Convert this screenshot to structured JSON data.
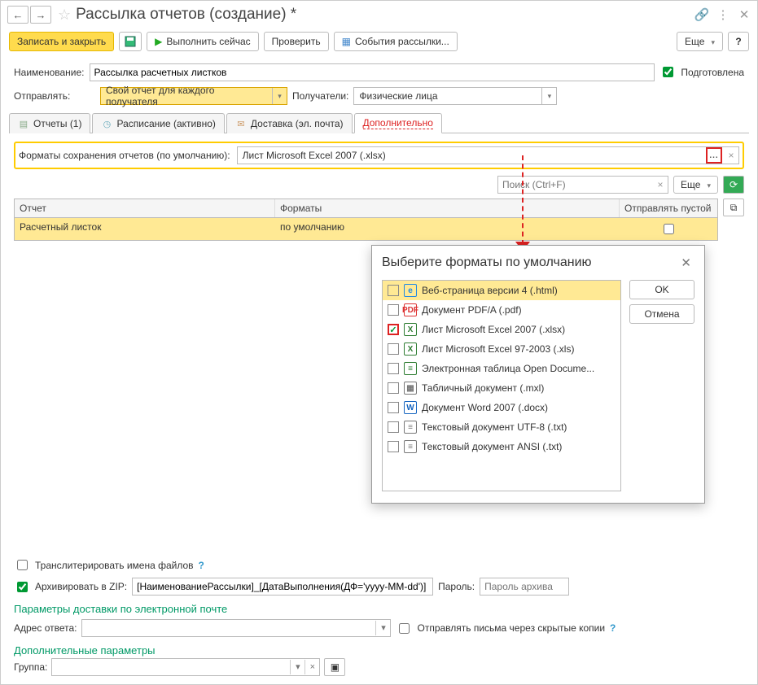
{
  "title": "Рассылка отчетов (создание) *",
  "toolbar": {
    "write_close": "Записать и закрыть",
    "execute_now": "Выполнить сейчас",
    "check": "Проверить",
    "events": "События рассылки...",
    "more": "Еще",
    "help": "?"
  },
  "form": {
    "name_label": "Наименование:",
    "name_value": "Рассылка расчетных листков",
    "prepared_label": "Подготовлена",
    "send_label": "Отправлять:",
    "send_value": "Свой отчет для каждого получателя",
    "recipients_label": "Получатели:",
    "recipients_value": "Физические лица"
  },
  "tabs": {
    "reports": "Отчеты (1)",
    "schedule": "Расписание (активно)",
    "delivery": "Доставка (эл. почта)",
    "additional": "Дополнительно"
  },
  "additional": {
    "formats_label": "Форматы сохранения отчетов (по умолчанию):",
    "formats_value": "Лист Microsoft Excel 2007 (.xlsx)",
    "search_placeholder": "Поиск (Ctrl+F)",
    "more": "Еще",
    "columns": {
      "report": "Отчет",
      "formats": "Форматы",
      "send_empty": "Отправлять пустой"
    },
    "rows": [
      {
        "report": "Расчетный листок",
        "formats": "по умолчанию",
        "send_empty": false
      }
    ]
  },
  "popup": {
    "title": "Выберите форматы по умолчанию",
    "ok": "OK",
    "cancel": "Отмена",
    "items": [
      {
        "label": "Веб-страница версии 4 (.html)",
        "checked": false,
        "icon": "e",
        "color": "#1e88e5",
        "selected": true
      },
      {
        "label": "Документ PDF/A (.pdf)",
        "checked": false,
        "icon": "PDF",
        "color": "#d33"
      },
      {
        "label": "Лист Microsoft Excel 2007 (.xlsx)",
        "checked": true,
        "icon": "X",
        "color": "#2e7d32",
        "highlight_cb": true
      },
      {
        "label": "Лист Microsoft Excel 97-2003 (.xls)",
        "checked": false,
        "icon": "X",
        "color": "#2e7d32"
      },
      {
        "label": "Электронная таблица Open Docume...",
        "checked": false,
        "icon": "≡",
        "color": "#2e7d32"
      },
      {
        "label": "Табличный документ (.mxl)",
        "checked": false,
        "icon": "▦",
        "color": "#777"
      },
      {
        "label": "Документ Word 2007 (.docx)",
        "checked": false,
        "icon": "W",
        "color": "#1565c0"
      },
      {
        "label": "Текстовый документ UTF-8 (.txt)",
        "checked": false,
        "icon": "≡",
        "color": "#777"
      },
      {
        "label": "Текстовый документ ANSI (.txt)",
        "checked": false,
        "icon": "≡",
        "color": "#777"
      }
    ]
  },
  "bottom": {
    "translit_label": "Транслитерировать имена файлов",
    "zip_label": "Архивировать в ZIP:",
    "zip_value": "[НаименованиеРассылки]_[ДатаВыполнения(ДФ='yyyy-MM-dd')]",
    "password_label": "Пароль:",
    "password_placeholder": "Пароль архива",
    "email_section": "Параметры доставки по электронной почте",
    "reply_label": "Адрес ответа:",
    "bcc_label": "Отправлять письма через скрытые копии",
    "extra_section": "Дополнительные параметры",
    "group_label": "Группа:"
  }
}
